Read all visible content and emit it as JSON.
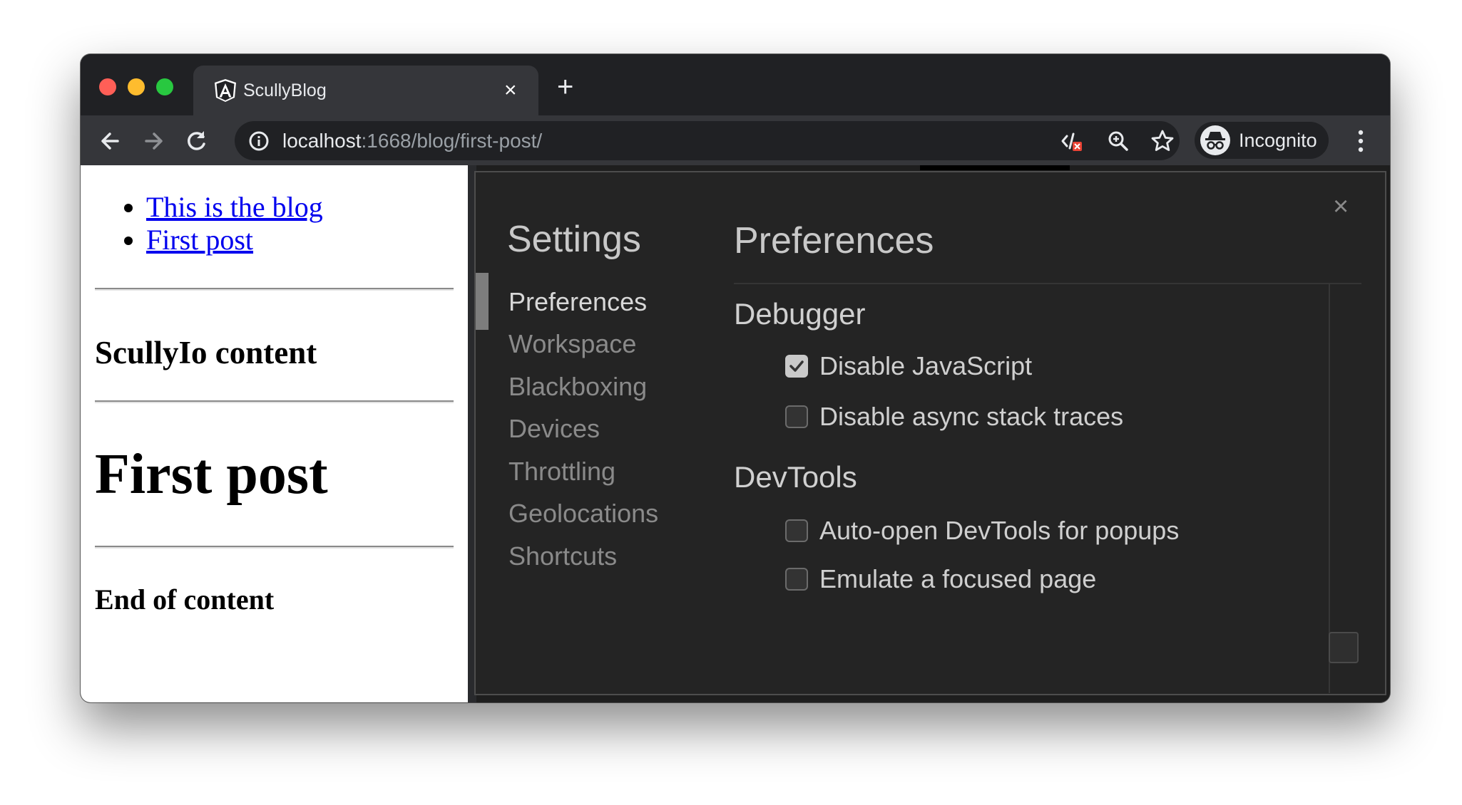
{
  "browser": {
    "tab_title": "ScullyBlog",
    "tab_close": "×",
    "new_tab": "+",
    "url_host": "localhost",
    "url_rest": ":1668/blog/first-post/",
    "profile_label": "Incognito"
  },
  "page": {
    "nav_links": [
      "This is the blog",
      "First post"
    ],
    "subtitle": "ScullyIo content",
    "title": "First post",
    "footer": "End of content"
  },
  "settings": {
    "title": "Settings",
    "close": "×",
    "nav": [
      "Preferences",
      "Workspace",
      "Blackboxing",
      "Devices",
      "Throttling",
      "Geolocations",
      "Shortcuts"
    ],
    "active_nav": "Preferences",
    "panel_title": "Preferences",
    "sections": [
      {
        "title": "Debugger",
        "options": [
          {
            "label": "Disable JavaScript",
            "checked": true
          },
          {
            "label": "Disable async stack traces",
            "checked": false
          }
        ]
      },
      {
        "title": "DevTools",
        "options": [
          {
            "label": "Auto-open DevTools for popups",
            "checked": false
          },
          {
            "label": "Emulate a focused page",
            "checked": false
          }
        ]
      }
    ]
  },
  "icons": {
    "back": "back-arrow-icon",
    "forward": "forward-arrow-icon",
    "reload": "reload-icon",
    "site_info": "info-icon",
    "blocked_script": "javascript-blocked-icon",
    "zoom": "zoom-icon",
    "bookmark": "star-icon",
    "incognito": "incognito-icon",
    "menu": "kebab-menu-icon",
    "tab_logo": "angular-logo-icon"
  },
  "colors": {
    "chrome_dark": "#202124",
    "toolbar": "#35363a",
    "link": "#0000ee",
    "settings_bg": "#242424"
  }
}
